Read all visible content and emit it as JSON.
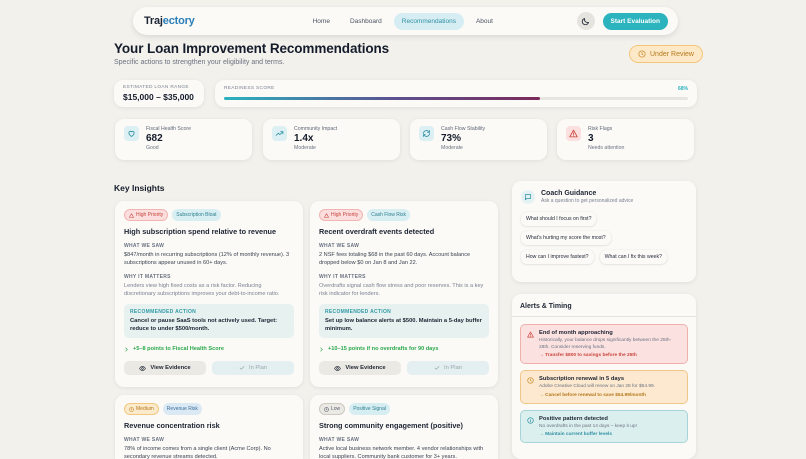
{
  "nav": {
    "brand_main": "Traj",
    "brand_accent": "ectory",
    "links": [
      "Home",
      "Dashboard",
      "Recommendations",
      "About"
    ],
    "cta": "Start Evaluation"
  },
  "header": {
    "title": "Your Loan Improvement Recommendations",
    "subtitle": "Specific actions to strengthen your eligibility and terms.",
    "status": "Under Review"
  },
  "loan": {
    "label": "ESTIMATED LOAN RANGE",
    "value": "$15,000 – $35,000"
  },
  "readiness": {
    "label": "READINESS SCORE",
    "value": "68%",
    "fraction": 0.68
  },
  "metrics": [
    {
      "label": "Fiscal Health Score",
      "value": "682",
      "sub": "Good",
      "icon": "heart-icon",
      "bg": "#dceff3",
      "fg": "#2f8fa3"
    },
    {
      "label": "Community Impact",
      "value": "1.4x",
      "sub": "Moderate",
      "icon": "trend-up-icon",
      "bg": "#dceff3",
      "fg": "#2f8fa3"
    },
    {
      "label": "Cash Flow Stability",
      "value": "73%",
      "sub": "Moderate",
      "icon": "refresh-icon",
      "bg": "#dceff3",
      "fg": "#2f8fa3"
    },
    {
      "label": "Risk Flags",
      "value": "3",
      "sub": "Needs attention",
      "icon": "warning-icon",
      "bg": "#fbe0df",
      "fg": "#c9443a"
    }
  ],
  "insights_title": "Key Insights",
  "insights": [
    {
      "priority": "High Priority",
      "category": "Subscription Bloat",
      "title": "High subscription spend relative to revenue",
      "saw_label": "WHAT WE SAW",
      "saw": "$847/month in recurring subscriptions (12% of monthly revenue). 3 subscriptions appear unused in 60+ days.",
      "matters_label": "WHY IT MATTERS",
      "matters": "Lenders view high fixed costs as a risk factor. Reducing discretionary subscriptions improves your debt-to-income ratio.",
      "action_label": "RECOMMENDED ACTION",
      "action": "Cancel or pause SaaS tools not actively used. Target: reduce to under $500/month.",
      "impact": "+5–8 points to Fiscal Health Score",
      "evidence_label": "View Evidence",
      "plan_label": "In Plan"
    },
    {
      "priority": "High Priority",
      "category": "Cash Flow Risk",
      "title": "Recent overdraft events detected",
      "saw_label": "WHAT WE SAW",
      "saw": "2 NSF fees totaling $68 in the past 60 days. Account balance dropped below $0 on Jan 8 and Jan 22.",
      "matters_label": "WHY IT MATTERS",
      "matters": "Overdrafts signal cash flow stress and poor reserves. This is a key risk indicator for lenders.",
      "action_label": "RECOMMENDED ACTION",
      "action": "Set up low balance alerts at $500. Maintain a 5-day buffer minimum.",
      "impact": "+10–15 points if no overdrafts for 90 days",
      "evidence_label": "View Evidence",
      "plan_label": "In Plan"
    },
    {
      "priority": "Medium",
      "category": "Revenue Risk",
      "title": "Revenue concentration risk",
      "saw_label": "WHAT WE SAW",
      "saw": "78% of income comes from a single client (Acme Corp). No secondary revenue streams detected."
    },
    {
      "priority": "Low",
      "category": "Positive Signal",
      "title": "Strong community engagement (positive)",
      "saw_label": "WHAT WE SAW",
      "saw": "Active local business network member. 4 vendor relationships with local suppliers. Community bank customer for 3+ years."
    }
  ],
  "coach": {
    "title": "Coach Guidance",
    "subtitle": "Ask a question to get personalized advice",
    "chips": [
      "What should I focus on first?",
      "What's hurting my score the most?",
      "How can I improve fastest?",
      "What can I fix this week?"
    ]
  },
  "alerts": {
    "title": "Alerts & Timing",
    "items": [
      {
        "title": "End of month approaching",
        "text": "Historically, your balance drops significantly between the 25th-28th. Consider reserving funds.",
        "action": "→ Transfer $800 to savings before the 25th"
      },
      {
        "title": "Subscription renewal in 5 days",
        "text": "Adobe Creative Cloud will renew on Jan 28 for $54.99.",
        "action": "→ Cancel before renewal to save $54.99/month"
      },
      {
        "title": "Positive pattern detected",
        "text": "No overdrafts in the past 14 days – keep it up!",
        "action": "→ Maintain current buffer levels"
      }
    ]
  }
}
